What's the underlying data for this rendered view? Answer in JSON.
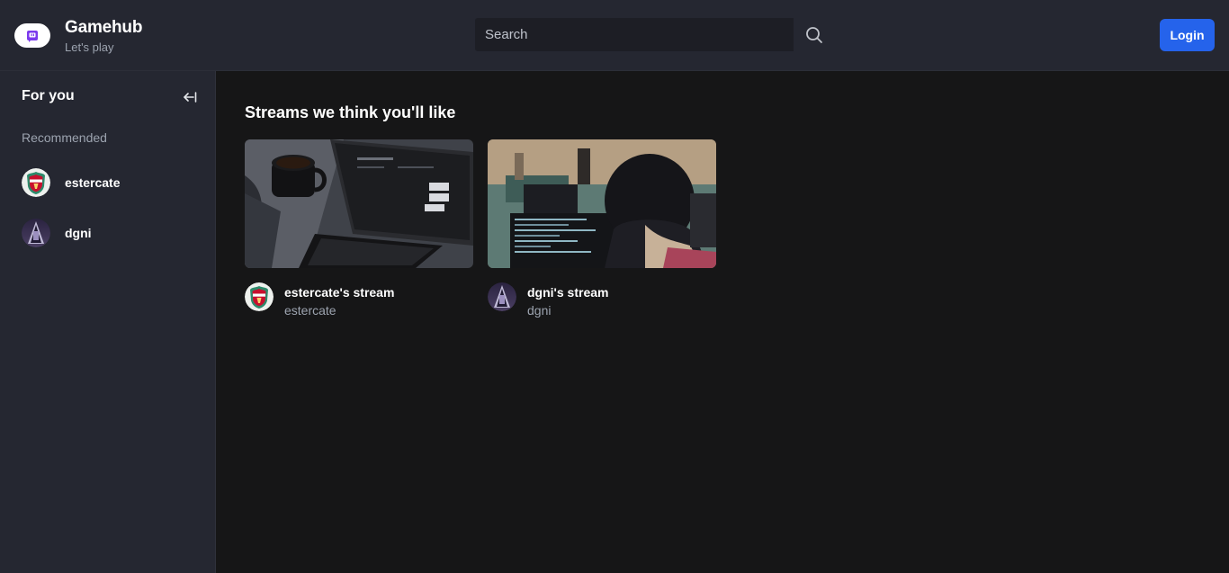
{
  "header": {
    "brand_title": "Gamehub",
    "brand_subtitle": "Let's play",
    "logo_icon": "twitch-logo-icon",
    "search_placeholder": "Search",
    "search_value": "",
    "search_icon": "search-icon",
    "login_label": "Login",
    "accent_color": "#2563eb"
  },
  "sidebar": {
    "heading": "For you",
    "collapse_icon": "collapse-left-icon",
    "section_label": "Recommended",
    "items": [
      {
        "name": "estercate",
        "avatar_icon": "liverpool-crest-avatar"
      },
      {
        "name": "dgni",
        "avatar_icon": "dark-portrait-avatar"
      }
    ]
  },
  "main": {
    "title": "Streams we think you'll like",
    "streams": [
      {
        "title": "estercate's stream",
        "user": "estercate",
        "thumbnail": "laptop-and-coffee-image"
      },
      {
        "title": "dgni's stream",
        "user": "dgni",
        "thumbnail": "person-coding-image"
      }
    ]
  }
}
